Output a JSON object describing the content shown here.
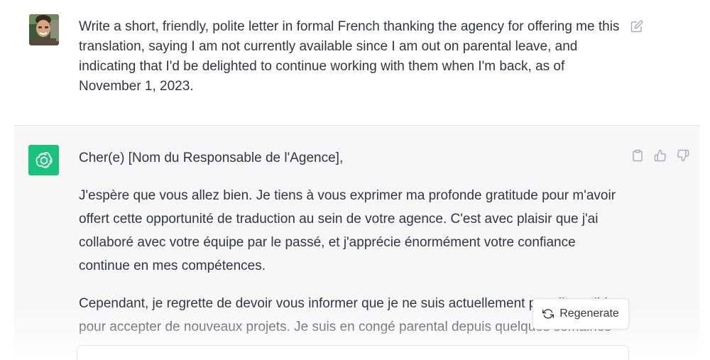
{
  "user_message": {
    "text": "Write a short, friendly, polite letter in formal French thanking the agency for offering me this translation, saying I am not currently available since I am out on parental leave, and indicating that I'd be delighted to continue working with them when I'm back, as of November 1, 2023.",
    "avatar_icon": "user-photo",
    "edit_icon": "edit-icon"
  },
  "assistant_message": {
    "salutation": "Cher(e) [Nom du Responsable de l'Agence],",
    "paragraphs": [
      "J'espère que vous allez bien. Je tiens à vous exprimer ma profonde gratitude pour m'avoir offert cette opportunité de traduction au sein de votre agence. C'est avec plaisir que j'ai collaboré avec votre équipe par le passé, et j'apprécie énormément votre confiance continue en mes compétences.",
      "Cependant, je regrette de devoir vous informer que je ne suis actuellement pas disponible pour accepter de nouveaux projets. Je suis en congé parental depuis quelques semaines"
    ],
    "avatar_icon": "openai-logo-icon",
    "avatar_color": "#19c37d",
    "actions": [
      "copy-icon",
      "thumbs-up-icon",
      "thumbs-down-icon"
    ]
  },
  "regenerate": {
    "label": "Regenerate",
    "icon": "refresh-icon"
  }
}
